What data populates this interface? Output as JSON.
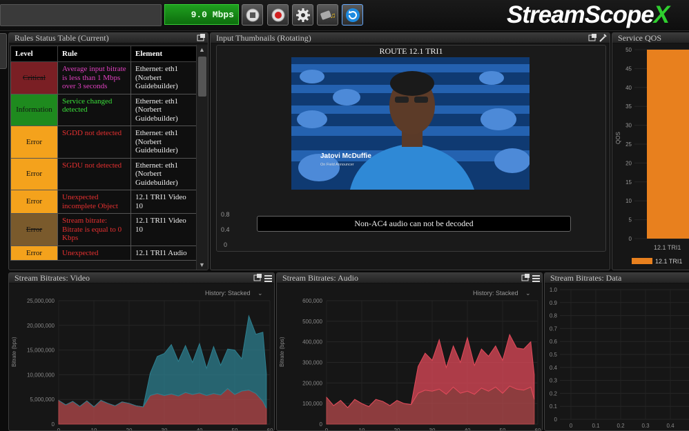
{
  "topbar": {
    "bitrate": "9.0 Mbps",
    "logo_main": "StreamScope",
    "logo_suffix": "X",
    "buttons": [
      "stop-icon",
      "record-icon",
      "gear-icon",
      "media-icon",
      "refresh-icon"
    ]
  },
  "rules_panel": {
    "title": "Rules Status Table (Current)",
    "headers": [
      "Level",
      "Rule",
      "Element"
    ],
    "rows": [
      {
        "level": "Critical",
        "rule": "Average input bitrate is less than 1 Mbps over 3 seconds",
        "element": "Ethernet: eth1 (Norbert Guidebuilder)",
        "level_bg": "#7a1f24",
        "rule_color": "#e040c0",
        "strike": true
      },
      {
        "level": "Information",
        "rule": "Service changed detected",
        "element": "Ethernet: eth1 (Norbert Guidebuilder)",
        "level_bg": "#1e8a1e",
        "rule_color": "#3ae03a",
        "strike": false
      },
      {
        "level": "Error",
        "rule": "SGDD not detected",
        "element": "Ethernet: eth1 (Norbert Guidebuilder)",
        "level_bg": "#f4a21c",
        "rule_color": "#e63030",
        "strike": false
      },
      {
        "level": "Error",
        "rule": "SGDU not detected",
        "element": "Ethernet: eth1 (Norbert Guidebuilder)",
        "level_bg": "#f4a21c",
        "rule_color": "#e63030",
        "strike": false
      },
      {
        "level": "Error",
        "rule": "Unexpected incomplete Object",
        "element": "12.1 TRI1 Video 10",
        "level_bg": "#f4a21c",
        "rule_color": "#e63030",
        "strike": false
      },
      {
        "level": "Error",
        "rule": "Stream bitrate: Bitrate is equal to 0 Kbps",
        "element": "12.1 TRI1 Video 10",
        "level_bg": "#7a5a2c",
        "rule_color": "#e63030",
        "strike": true
      },
      {
        "level": "Error",
        "rule": "Unexpected",
        "element": "12.1 TRI1 Audio",
        "level_bg": "#f4a21c",
        "rule_color": "#e63030",
        "strike": false
      }
    ]
  },
  "thumbs_panel": {
    "title": "Input Thumbnails (Rotating)",
    "route": "ROUTE 12.1 TRI1",
    "lower_third_name": "Jatovi McDuffie",
    "lower_third_role": "On Field Announcer",
    "audio_msg": "Non-AC4 audio can not be decoded",
    "axis": [
      "0.8",
      "0.4",
      "0"
    ]
  },
  "qos_panel": {
    "title": "Service QOS",
    "ylabel": "QOS",
    "yticks": [
      "50",
      "45",
      "40",
      "35",
      "30",
      "25",
      "20",
      "15",
      "10",
      "5",
      "0"
    ],
    "xlabel": "12.1 TRI1",
    "legend": "12.1 TRI1",
    "bar_color": "#e8801e"
  },
  "video_panel": {
    "title": "Stream Bitrates: Video",
    "history": "History: Stacked",
    "ylabel": "Bitrate (bps)",
    "yticks": [
      "25,000,000",
      "20,000,000",
      "15,000,000",
      "10,000,000",
      "5,000,000",
      "0"
    ],
    "xticks": [
      "0",
      "10",
      "20",
      "30",
      "40",
      "50",
      "60"
    ]
  },
  "audio_panel": {
    "title": "Stream Bitrates: Audio",
    "history": "History: Stacked",
    "ylabel": "Bitrate (bps)",
    "yticks": [
      "600,000",
      "500,000",
      "400,000",
      "300,000",
      "200,000",
      "100,000",
      "0"
    ],
    "xticks": [
      "0",
      "10",
      "20",
      "30",
      "40",
      "50",
      "60"
    ]
  },
  "data_panel": {
    "title": "Stream Bitrates: Data",
    "yticks": [
      "1.0",
      "0.9",
      "0.8",
      "0.7",
      "0.6",
      "0.5",
      "0.4",
      "0.3",
      "0.2",
      "0.1",
      "0"
    ],
    "xticks": [
      "0",
      "0.1",
      "0.2",
      "0.3",
      "0.4",
      "0.5"
    ]
  },
  "chart_data": [
    {
      "type": "area",
      "title": "Stream Bitrates: Video",
      "ylabel": "Bitrate (bps)",
      "xlim": [
        0,
        60
      ],
      "ylim": [
        0,
        25000000
      ],
      "x": [
        0,
        2,
        4,
        6,
        8,
        10,
        12,
        14,
        16,
        18,
        20,
        22,
        24,
        26,
        28,
        30,
        32,
        34,
        36,
        38,
        40,
        42,
        44,
        46,
        48,
        50,
        52,
        54,
        56,
        58,
        59
      ],
      "series": [
        {
          "values": [
            4800000,
            3900000,
            4600000,
            3600000,
            4700000,
            3500000,
            4800000,
            4200000,
            3700000,
            4500000,
            4200000,
            3700000,
            3500000,
            5800000,
            6200000,
            5800000,
            6100000,
            5700000,
            6400000,
            6000000,
            6300000,
            5800000,
            6200000,
            5900000,
            7200000,
            6000000,
            6700000,
            6900000,
            6200000,
            4600000,
            3200000
          ],
          "color": "#b5494c"
        },
        {
          "values": [
            0,
            0,
            0,
            0,
            0,
            0,
            0,
            0,
            0,
            0,
            0,
            0,
            0,
            4500000,
            7500000,
            8500000,
            10000000,
            7000000,
            9500000,
            6500000,
            10000000,
            5500000,
            9500000,
            6000000,
            8000000,
            9000000,
            6500000,
            15000000,
            12000000,
            14000000,
            7000000
          ],
          "color": "#2d7f8f"
        }
      ]
    },
    {
      "type": "area",
      "title": "Stream Bitrates: Audio",
      "ylabel": "Bitrate (bps)",
      "xlim": [
        0,
        60
      ],
      "ylim": [
        0,
        600000
      ],
      "x": [
        0,
        2,
        4,
        6,
        8,
        10,
        12,
        14,
        16,
        18,
        20,
        22,
        24,
        26,
        28,
        30,
        32,
        34,
        36,
        38,
        40,
        42,
        44,
        46,
        48,
        50,
        52,
        54,
        56,
        58,
        59
      ],
      "series": [
        {
          "values": [
            130000,
            90000,
            115000,
            80000,
            120000,
            100000,
            85000,
            120000,
            110000,
            90000,
            115000,
            100000,
            95000,
            150000,
            165000,
            160000,
            170000,
            145000,
            180000,
            150000,
            160000,
            145000,
            175000,
            160000,
            180000,
            150000,
            185000,
            170000,
            165000,
            180000,
            120000
          ],
          "color": "#b5494c"
        },
        {
          "values": [
            0,
            0,
            0,
            0,
            0,
            0,
            0,
            0,
            0,
            0,
            0,
            0,
            0,
            130000,
            180000,
            150000,
            240000,
            130000,
            200000,
            150000,
            260000,
            140000,
            190000,
            170000,
            200000,
            160000,
            250000,
            200000,
            200000,
            220000,
            120000
          ],
          "color": "#e04a5a"
        }
      ]
    },
    {
      "type": "bar",
      "title": "Service QOS",
      "ylabel": "QOS",
      "categories": [
        "12.1 TRI1"
      ],
      "values": [
        50
      ],
      "ylim": [
        0,
        50
      ]
    }
  ]
}
